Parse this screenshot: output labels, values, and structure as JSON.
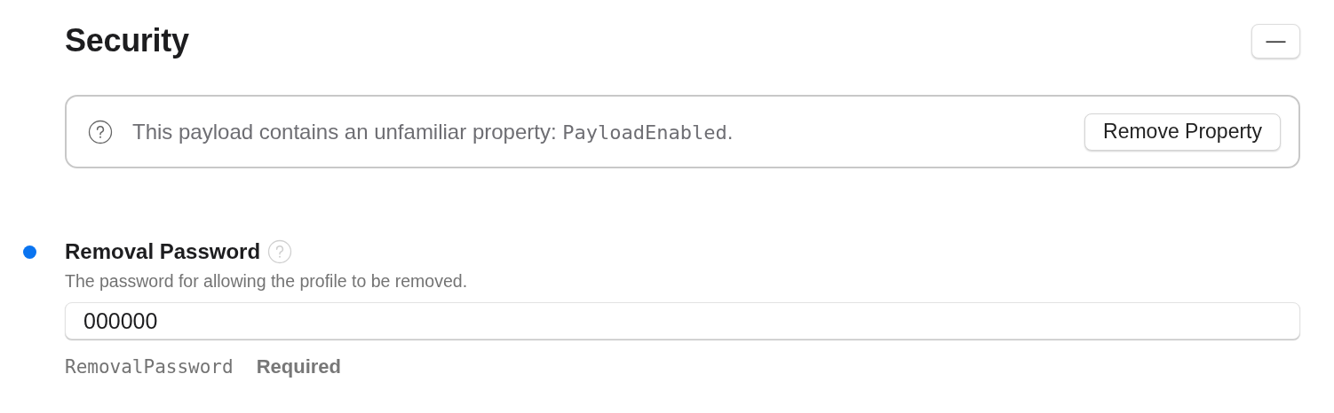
{
  "section": {
    "title": "Security",
    "collapse_button": "—"
  },
  "notice": {
    "text": "This payload contains an unfamiliar property: ",
    "code": "PayloadEnabled",
    "suffix": ".",
    "button": "Remove Property"
  },
  "field": {
    "label": "Removal Password",
    "modified": true,
    "description": "The password for allowing the profile to be removed.",
    "value": "000000",
    "key": "RemovalPassword",
    "requirement": "Required"
  }
}
